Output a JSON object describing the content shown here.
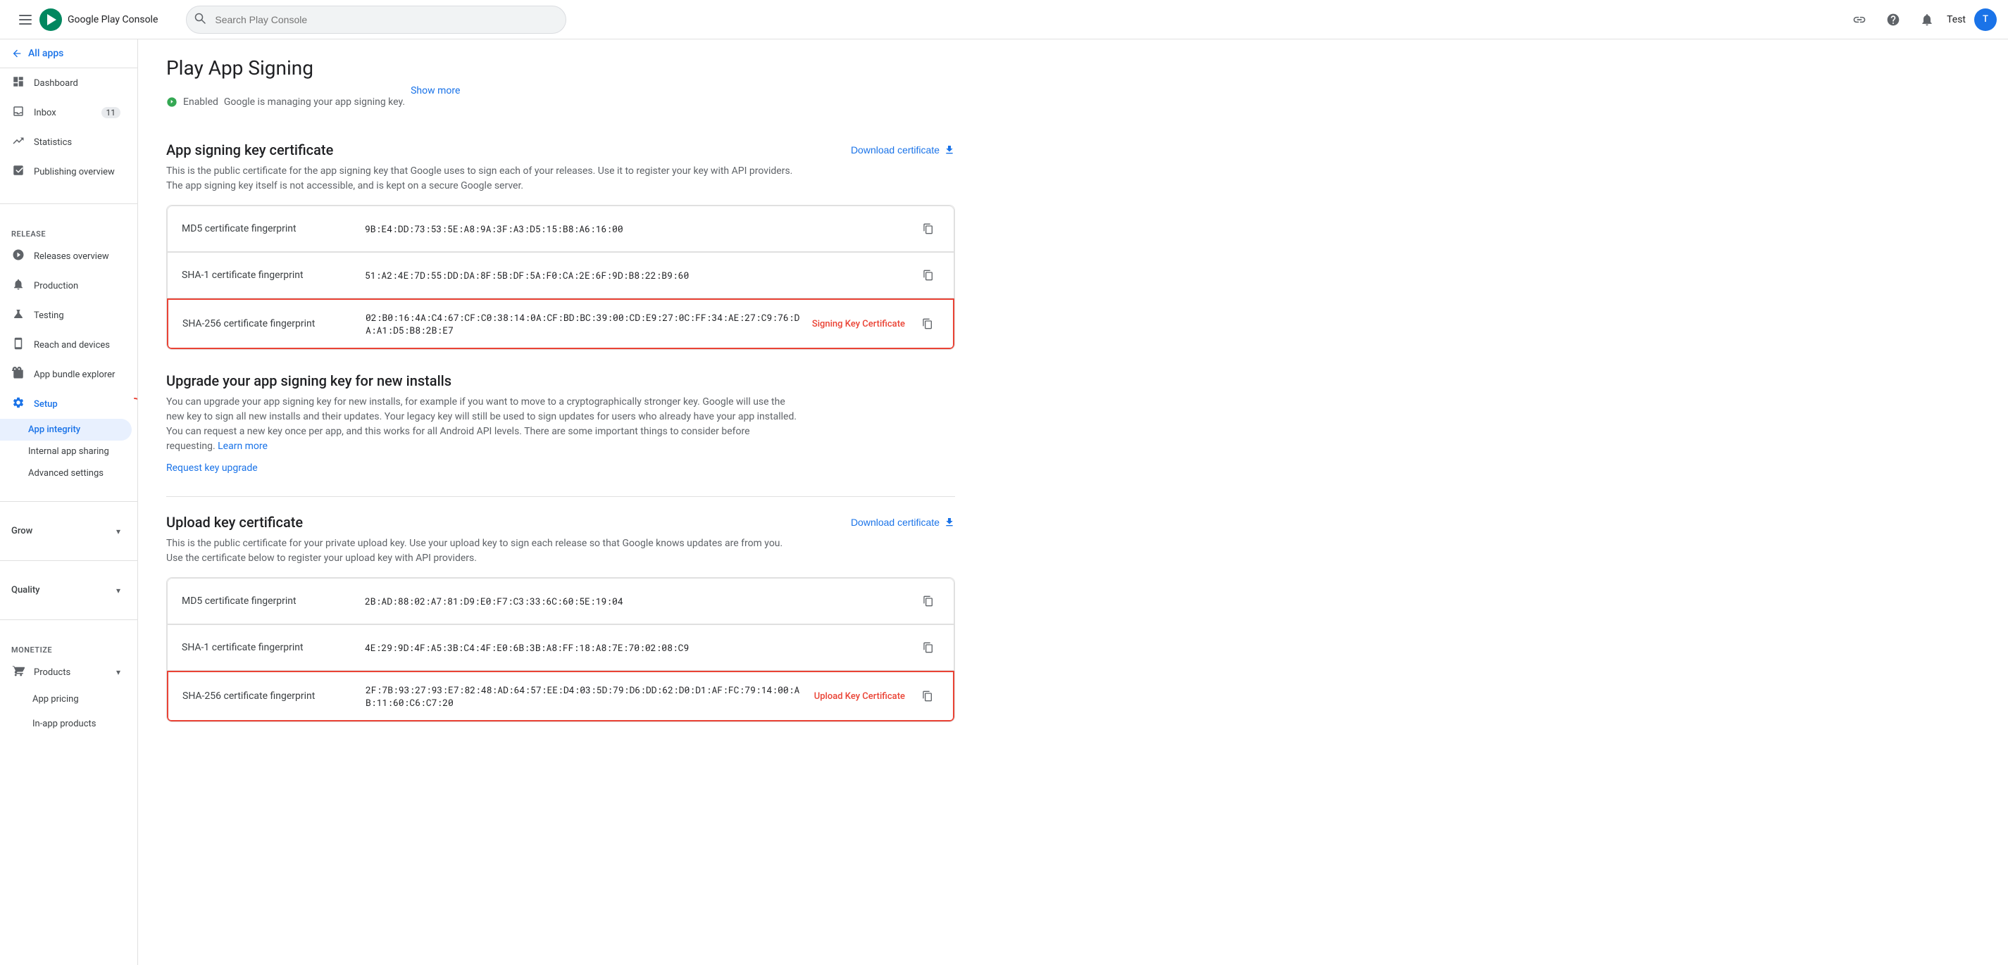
{
  "topbar": {
    "menu_icon": "≡",
    "logo_text": "Google Play Console",
    "search_placeholder": "Search Play Console",
    "help_icon": "?",
    "notifications_icon": "🔔",
    "user_name": "Test",
    "avatar_letter": "T"
  },
  "sidebar": {
    "all_apps_label": "All apps",
    "nav_items": [
      {
        "id": "dashboard",
        "label": "Dashboard",
        "icon": "⊞",
        "badge": null
      },
      {
        "id": "inbox",
        "label": "Inbox",
        "icon": "✉",
        "badge": "11"
      },
      {
        "id": "statistics",
        "label": "Statistics",
        "icon": "📊",
        "badge": null
      },
      {
        "id": "publishing-overview",
        "label": "Publishing overview",
        "icon": "📋",
        "badge": null
      }
    ],
    "release_section": "Release",
    "release_items": [
      {
        "id": "releases-overview",
        "label": "Releases overview",
        "icon": "🚀",
        "badge": null
      },
      {
        "id": "production",
        "label": "Production",
        "icon": "🔔",
        "badge": null
      },
      {
        "id": "testing",
        "label": "Testing",
        "icon": "⚗",
        "badge": null
      },
      {
        "id": "reach-and-devices",
        "label": "Reach and devices",
        "icon": "📱",
        "badge": null
      },
      {
        "id": "app-bundle-explorer",
        "label": "App bundle explorer",
        "icon": "📦",
        "badge": null
      },
      {
        "id": "setup",
        "label": "Setup",
        "icon": "⚙",
        "badge": null
      }
    ],
    "setup_sub_items": [
      {
        "id": "app-integrity",
        "label": "App integrity",
        "active": true
      },
      {
        "id": "internal-app-sharing",
        "label": "Internal app sharing",
        "active": false
      },
      {
        "id": "advanced-settings",
        "label": "Advanced settings",
        "active": false
      }
    ],
    "grow_section": "Grow",
    "quality_section": "Quality",
    "monetize_section": "Monetize",
    "monetize_items": [
      {
        "id": "products",
        "label": "Products",
        "icon": "🛒",
        "badge": null
      },
      {
        "id": "app-pricing",
        "label": "App pricing",
        "icon": "",
        "badge": null
      },
      {
        "id": "in-app-products",
        "label": "In-app products",
        "icon": "",
        "badge": null
      }
    ]
  },
  "main": {
    "page_title": "Play App Signing",
    "page_subtitle_enabled": "Enabled",
    "page_subtitle_desc": "Google is managing your app signing key.",
    "page_subtitle_show_more": "Show more",
    "signing_key_section": {
      "title": "App signing key certificate",
      "download_label": "Download certificate",
      "description": "This is the public certificate for the app signing key that Google uses to sign each of your releases. Use it to register your key with API providers. The app signing key itself is not accessible, and is kept on a secure Google server.",
      "rows": [
        {
          "label": "MD5 certificate fingerprint",
          "value": "9B:E4:DD:73:53:5E:A8:9A:3F:A3:D5:15:B8:A6:16:00",
          "highlighted": false,
          "badge": null
        },
        {
          "label": "SHA-1 certificate fingerprint",
          "value": "51:A2:4E:7D:55:DD:DA:8F:5B:DF:5A:F0:CA:2E:6F:9D:B8:22:B9:60",
          "highlighted": false,
          "badge": null
        },
        {
          "label": "SHA-256 certificate fingerprint",
          "value": "02:B0:16:4A:C4:67:CF:C0:38:14:0A:CF:BD:BC:39:00:CD:E9:27:0C:FF:34:AE:27:C9:76:DA:A1:D5:B8:2B:E7",
          "highlighted": true,
          "badge": "Signing Key Certificate"
        }
      ]
    },
    "upgrade_section": {
      "title": "Upgrade your app signing key for new installs",
      "description": "You can upgrade your app signing key for new installs, for example if you want to move to a cryptographically stronger key. Google will use the new key to sign all new installs and their updates. Your legacy key will still be used to sign updates for users who already have your app installed. You can request a new key once per app, and this works for all Android API levels. There are some important things to consider before requesting.",
      "learn_more": "Learn more",
      "request_link": "Request key upgrade"
    },
    "upload_key_section": {
      "title": "Upload key certificate",
      "download_label": "Download certificate",
      "description": "This is the public certificate for your private upload key. Use your upload key to sign each release so that Google knows updates are from you. Use the certificate below to register your upload key with API providers.",
      "rows": [
        {
          "label": "MD5 certificate fingerprint",
          "value": "2B:AD:88:02:A7:81:D9:E0:F7:C3:33:6C:60:5E:19:04",
          "highlighted": false,
          "badge": null
        },
        {
          "label": "SHA-1 certificate fingerprint",
          "value": "4E:29:9D:4F:A5:3B:C4:4F:E0:6B:3B:A8:FF:18:A8:7E:70:02:08:C9",
          "highlighted": false,
          "badge": null
        },
        {
          "label": "SHA-256 certificate fingerprint",
          "value": "2F:7B:93:27:93:E7:82:48:AD:64:57:EE:D4:03:5D:79:D6:DD:62:D0:D1:AF:FC:79:14:00:AB:11:60:C6:C7:20",
          "highlighted": true,
          "badge": "Upload Key Certificate"
        }
      ]
    }
  }
}
